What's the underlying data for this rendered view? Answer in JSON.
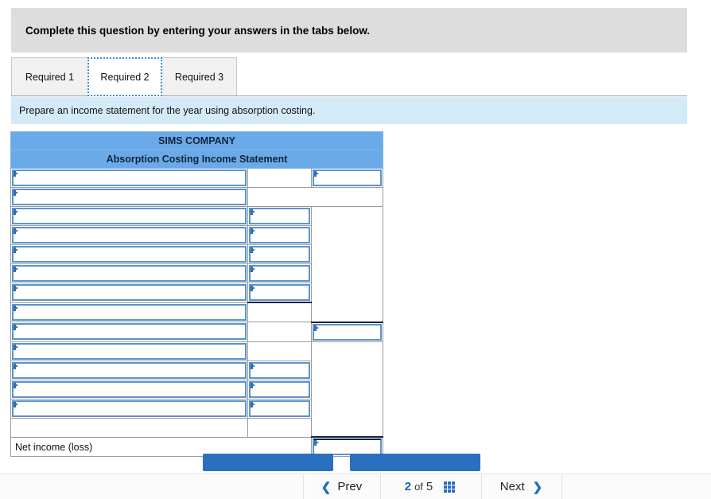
{
  "prompt": {
    "text": "Complete this question by entering your answers in the tabs below."
  },
  "tabs": [
    {
      "label": "Required 1",
      "active": false
    },
    {
      "label": "Required 2",
      "active": true
    },
    {
      "label": "Required 3",
      "active": false
    }
  ],
  "instruction": {
    "text": "Prepare an income statement for the year using absorption costing."
  },
  "worksheet": {
    "title": "SIMS COMPANY",
    "subtitle": "Absorption Costing Income Statement",
    "net_income_label": "Net income (loss)",
    "rows": [
      {
        "id": 1,
        "label_input": true,
        "mid": "empty",
        "right": "input"
      },
      {
        "id": 2,
        "label_input": true,
        "mid": "empty",
        "right": "span"
      },
      {
        "id": 3,
        "label_input": true,
        "mid": "input",
        "right": "tall-start"
      },
      {
        "id": 4,
        "label_input": true,
        "mid": "input",
        "right": "tall"
      },
      {
        "id": 5,
        "label_input": true,
        "mid": "input",
        "right": "tall"
      },
      {
        "id": 6,
        "label_input": true,
        "mid": "input",
        "right": "tall"
      },
      {
        "id": 7,
        "label_input": true,
        "mid": "input-dark",
        "right": "tall"
      },
      {
        "id": 8,
        "label_input": true,
        "mid": "empty",
        "right": "tall-end"
      },
      {
        "id": 9,
        "label_input": true,
        "mid": "empty",
        "right": "input-dark"
      },
      {
        "id": 10,
        "label_input": true,
        "mid": "empty",
        "right": "tall2-start"
      },
      {
        "id": 11,
        "label_input": true,
        "mid": "input",
        "right": "tall2"
      },
      {
        "id": 12,
        "label_input": true,
        "mid": "input",
        "right": "tall2"
      },
      {
        "id": 13,
        "label_input": true,
        "mid": "input",
        "right": "tall2"
      },
      {
        "id": 14,
        "label_input": false,
        "mid": "empty",
        "right": "tall2-end"
      },
      {
        "id": 15,
        "label_input": false,
        "mid": "label-net",
        "right": "input-dark"
      }
    ]
  },
  "action_buttons": [
    {
      "name": "previous-required-button",
      "label": ""
    },
    {
      "name": "next-required-button",
      "label": ""
    }
  ],
  "nav": {
    "prev_label": "Prev",
    "next_label": "Next",
    "current_page": "2",
    "of_label": "of",
    "total_pages": "5",
    "grid_icon": "grid-icon",
    "prev_icon": "chevron-left-icon",
    "next_icon": "chevron-right-icon"
  },
  "colors": {
    "header_blue": "#6aaae8",
    "input_border": "#5b93cd",
    "accent": "#1767ab",
    "banner_gray": "#dddddd",
    "instruction_blue": "#d5eaf8",
    "button_blue": "#2a6fc0"
  }
}
